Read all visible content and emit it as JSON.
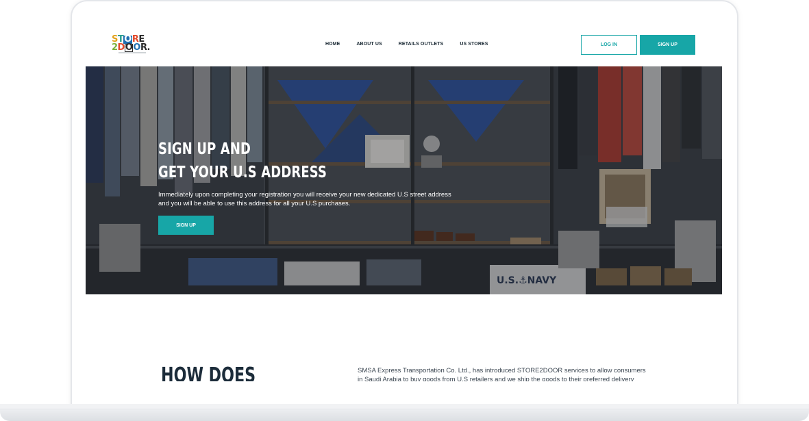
{
  "logo": {
    "row1": [
      "S",
      "T",
      "O",
      "R",
      "E"
    ],
    "row2": [
      "2",
      "D",
      "O",
      "O",
      "R",
      "."
    ],
    "colors": [
      "#e3a21a",
      "#2a9d8f",
      "#e24a2c",
      "#1f6fb2",
      "#2b2b2b",
      "#7bb03b"
    ]
  },
  "nav": {
    "items": [
      "HOME",
      "ABOUT US",
      "RETAILS OUTLETS",
      "US STORES"
    ]
  },
  "header": {
    "login_label": "LOG IN",
    "signup_label": "SIGN UP"
  },
  "hero": {
    "title_line1": "SIGN UP AND",
    "title_line2": "GET YOUR U.S ADDRESS",
    "description_line1": "Immediately upon completing your registration you will receive your new dedicated U.S street address",
    "description_line2": "and you will be able to use this address for all your U.S purchases.",
    "cta_label": "SIGN UP",
    "sign_text": "U.S.⚓NAVY"
  },
  "how": {
    "title": "HOW DOES",
    "text_line1": "SMSA Express Transportation Co. Ltd., has introduced STORE2DOOR services to allow consumers",
    "text_line2": "in Saudi Arabia to buy goods from U.S retailers and we ship the goods to their preferred delivery"
  },
  "colors": {
    "accent": "#17a6a7",
    "nav_text": "#1b2a35",
    "heading_dark": "#1c2c3a"
  }
}
